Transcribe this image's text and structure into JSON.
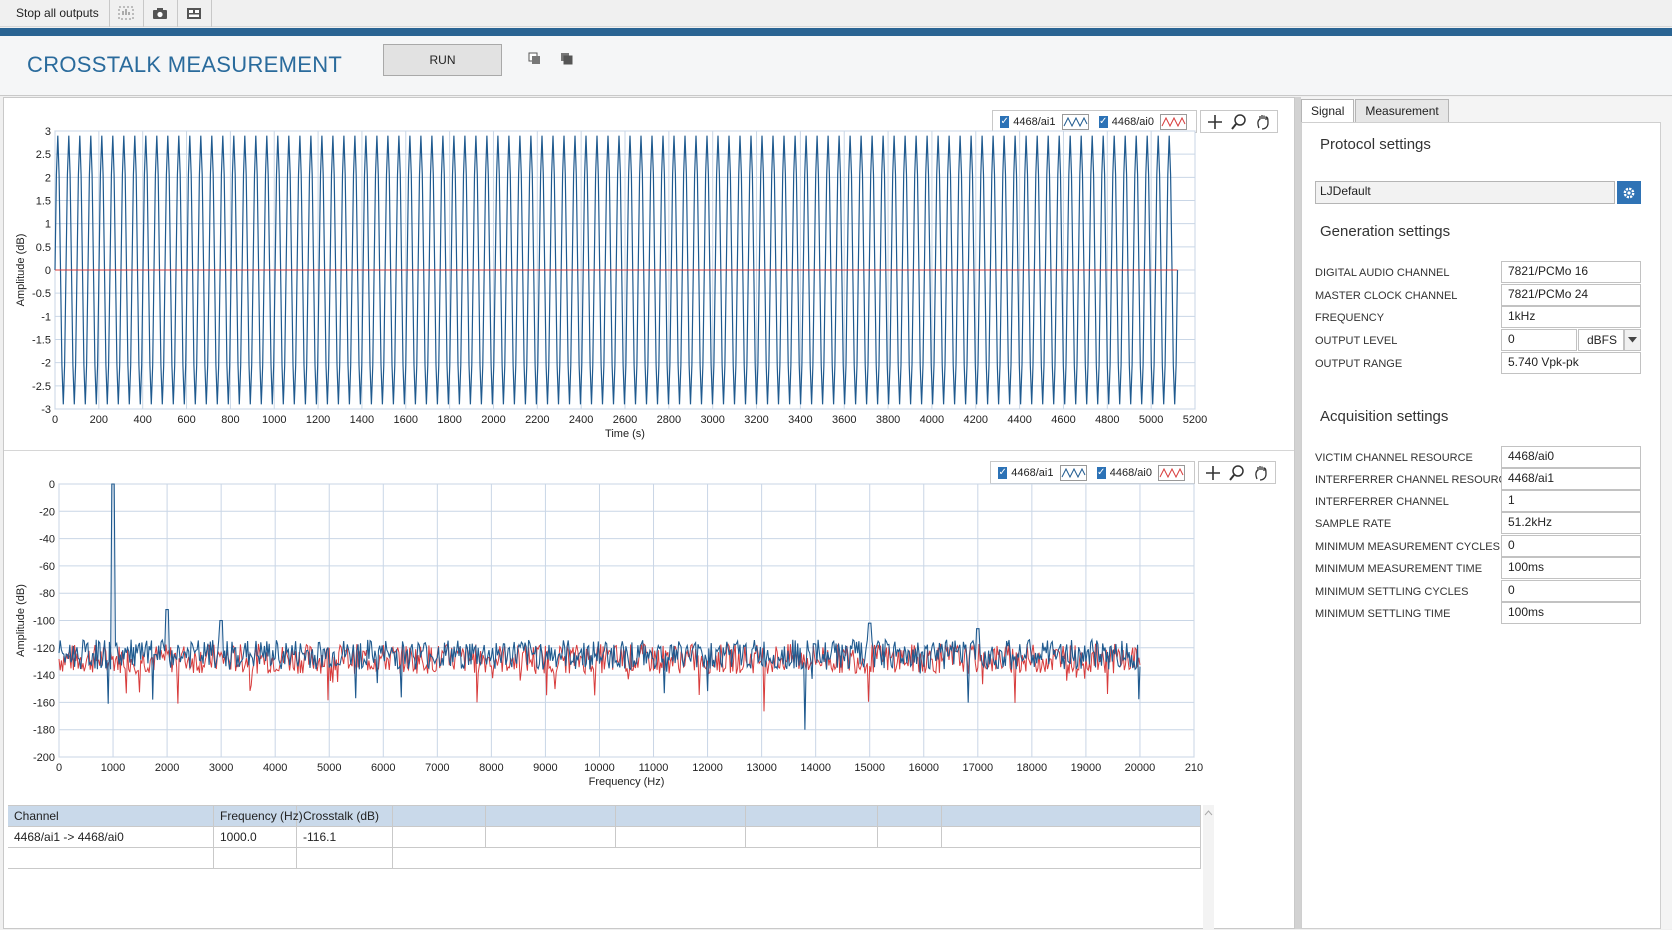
{
  "toolbar": {
    "stop_label": "Stop all outputs",
    "icons": [
      "compare-icon",
      "camera-icon",
      "layout-icon"
    ]
  },
  "header": {
    "title": "CROSSTALK MEASUREMENT",
    "run_label": "RUN",
    "icons": [
      "copy-icon",
      "paste-icon"
    ]
  },
  "tabs": [
    {
      "label": "Signal",
      "active": true
    },
    {
      "label": "Measurement",
      "active": false
    }
  ],
  "protocol": {
    "heading": "Protocol settings",
    "value": "LJDefault"
  },
  "generation": {
    "heading": "Generation settings",
    "rows": [
      {
        "label": "DIGITAL AUDIO CHANNEL",
        "value": "7821/PCMo 16"
      },
      {
        "label": "MASTER CLOCK CHANNEL",
        "value": "7821/PCMo 24"
      },
      {
        "label": "FREQUENCY",
        "value": "1kHz"
      },
      {
        "label": "OUTPUT LEVEL",
        "value": "0",
        "unit": "dBFS"
      },
      {
        "label": "OUTPUT RANGE",
        "value": "5.740 Vpk-pk"
      }
    ]
  },
  "acquisition": {
    "heading": "Acquisition settings",
    "rows": [
      {
        "label": "VICTIM CHANNEL RESOURCE",
        "value": "4468/ai0"
      },
      {
        "label": "INTERFERRER CHANNEL RESOURCE",
        "value": "4468/ai1"
      },
      {
        "label": "INTERFERRER CHANNEL",
        "value": "1"
      },
      {
        "label": "SAMPLE RATE",
        "value": "51.2kHz"
      },
      {
        "label": "MINIMUM MEASUREMENT CYCLES",
        "value": "0"
      },
      {
        "label": "MINIMUM MEASUREMENT TIME",
        "value": "100ms"
      },
      {
        "label": "MINIMUM SETTLING CYCLES",
        "value": "0"
      },
      {
        "label": "MINIMUM SETTLING TIME",
        "value": "100ms"
      }
    ]
  },
  "legend": {
    "series1": "4468/ai1",
    "series2": "4468/ai0"
  },
  "colors": {
    "accent": "#2a6493",
    "title": "#2a6b9c",
    "series_blue": "#1f5a8f",
    "series_red": "#d83c3c",
    "grid": "#c9d6e6",
    "table_header": "#c9d9ea"
  },
  "chart_data": [
    {
      "type": "line",
      "xlabel": "Time (s)",
      "ylabel": "Amplitude (dB)",
      "xlim": [
        0,
        5200
      ],
      "ylim": [
        -3,
        3
      ],
      "xticks": [
        "0",
        "200",
        "400",
        "600",
        "800",
        "1000",
        "1200",
        "1400",
        "1600",
        "1800",
        "2000",
        "2200",
        "2400",
        "2600",
        "2800",
        "3000",
        "3200",
        "3400",
        "3600",
        "3800",
        "4000",
        "4200",
        "4400",
        "4600",
        "4800",
        "5000",
        "5200"
      ],
      "yticks": [
        "3",
        "2.5",
        "2",
        "1.5",
        "1",
        "0.5",
        "0",
        "-0.5",
        "-1",
        "-1.5",
        "-2",
        "-2.5",
        "-3"
      ],
      "series": [
        {
          "name": "4468/ai1",
          "description": "sine wave",
          "amplitude": 2.9,
          "x_end": 5120,
          "cycles": 102
        },
        {
          "name": "4468/ai0",
          "constant": 0,
          "x_end": 5120
        }
      ]
    },
    {
      "type": "line",
      "xlabel": "Frequency (Hz)",
      "ylabel": "Amplitude (dB)",
      "xlim": [
        0,
        21000
      ],
      "ylim": [
        -200,
        0
      ],
      "xticks": [
        "0",
        "1000",
        "2000",
        "3000",
        "4000",
        "5000",
        "6000",
        "7000",
        "8000",
        "9000",
        "10000",
        "11000",
        "12000",
        "13000",
        "14000",
        "15000",
        "16000",
        "17000",
        "18000",
        "19000",
        "20000",
        "210"
      ],
      "yticks": [
        "0",
        "-20",
        "-40",
        "-60",
        "-80",
        "-100",
        "-120",
        "-140",
        "-160",
        "-180",
        "-200"
      ],
      "series": [
        {
          "name": "4468/ai1",
          "noise_floor": -125,
          "x_end": 20000,
          "peaks": [
            [
              1000,
              0
            ],
            [
              2000,
              -92
            ],
            [
              3000,
              -100
            ],
            [
              15000,
              -102
            ],
            [
              17000,
              -106
            ]
          ],
          "dips": [
            [
              13800,
              -180
            ]
          ]
        },
        {
          "name": "4468/ai0",
          "noise_floor": -128,
          "x_end": 20000
        }
      ]
    }
  ],
  "table": {
    "headers": [
      "Channel",
      "Frequency (Hz)",
      "Crosstalk (dB)"
    ],
    "rows": [
      [
        "4468/ai1 -> 4468/ai0",
        "1000.0",
        "-116.1"
      ]
    ]
  }
}
